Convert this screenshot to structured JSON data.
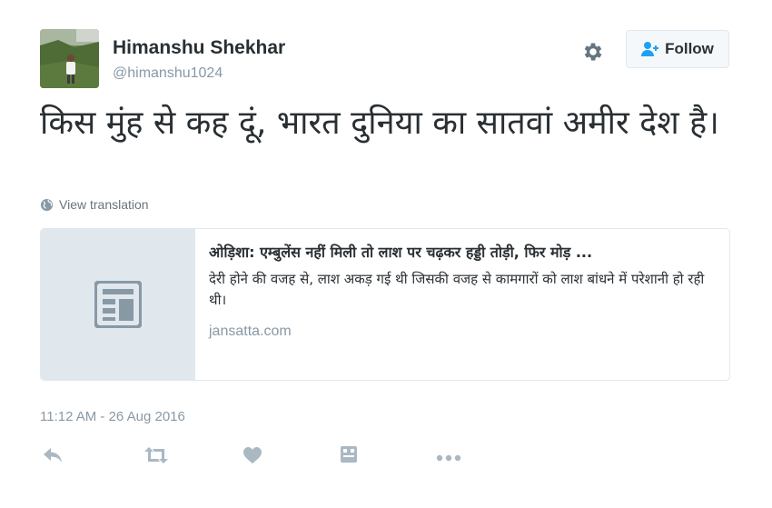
{
  "author": {
    "name": "Himanshu Shekhar",
    "handle": "@himanshu1024"
  },
  "header": {
    "follow_label": "Follow",
    "settings_icon": "gear-icon",
    "follow_icon": "person-add-icon"
  },
  "tweet": {
    "text": "किस मुंह से कह दूं, भारत दुनिया का सातवां अमीर देश है।",
    "translate_label": "View translation",
    "timestamp": "11:12 AM - 26 Aug 2016"
  },
  "card": {
    "title": "ओड़िशा: एम्बुलेंस नहीं मिली तो लाश पर चढ़कर हड्डी तोड़ी, फिर मोड़ ...",
    "description": "देरी होने की वजह से, लाश अकड़ गई थी जिसकी वजह से कामगारों को लाश बांधने में परेशानी हो रही थी।",
    "domain": "jansatta.com",
    "thumbnail_icon": "article-icon"
  },
  "actions": [
    "reply-icon",
    "retweet-icon",
    "like-icon",
    "embed-icon",
    "more-icon"
  ],
  "colors": {
    "text": "#292f33",
    "muted": "#8899a6",
    "link_blue": "#1da1f2",
    "border": "#e1e8ed",
    "icon_gray": "#aab8c2"
  }
}
